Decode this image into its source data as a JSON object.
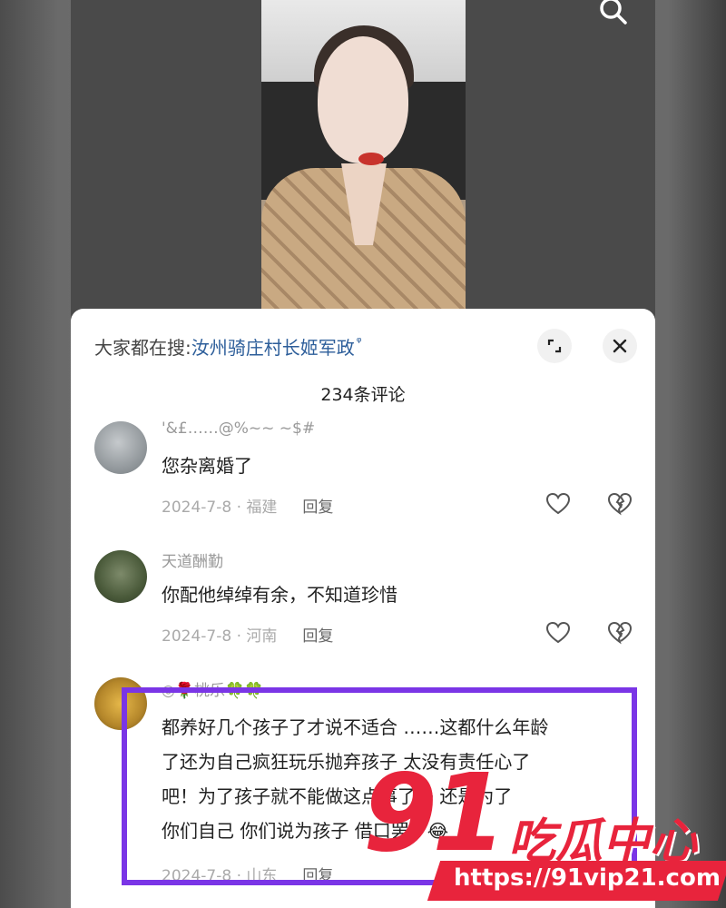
{
  "top_bar": {
    "search_icon": "search-icon"
  },
  "sheet": {
    "search_hint_label": "大家都在搜:",
    "search_hint_keyword": "汝州骑庄村长姬军政",
    "search_hint_icon": "ᵠ",
    "expand_icon": "expand-icon",
    "close_icon": "close-icon",
    "comment_count": "234条评论"
  },
  "comments": [
    {
      "username": "'&£……@%~~ ~$#",
      "text": "您杂离婚了",
      "date_location": "2024-7-8 · 福建",
      "reply": "回复"
    },
    {
      "username": "天道酬勤",
      "text": "你配他绰绰有余，不知道珍惜",
      "date_location": "2024-7-8 · 河南",
      "reply": "回复"
    },
    {
      "username": "◎🌹桃乐🍀🍀",
      "text_lines": [
        "都养好几个孩子了才说不适合 ……这都什么年龄",
        "了还为自己疯狂玩乐抛弃孩子 太没有责任心了",
        "吧！为了孩子就不能做这点事了吗 还是为了",
        "你们自己  你们说为孩子 借口罢了😂"
      ],
      "date_location": "2024-7-8 · 山东",
      "reply": "回复"
    }
  ],
  "watermark": {
    "number": "91",
    "name": "吃瓜中心",
    "url": "https://91vip21.com"
  },
  "colors": {
    "accent_link": "#2d5e9a",
    "highlight_border": "#7a35e6",
    "watermark_red": "#e8243c"
  }
}
